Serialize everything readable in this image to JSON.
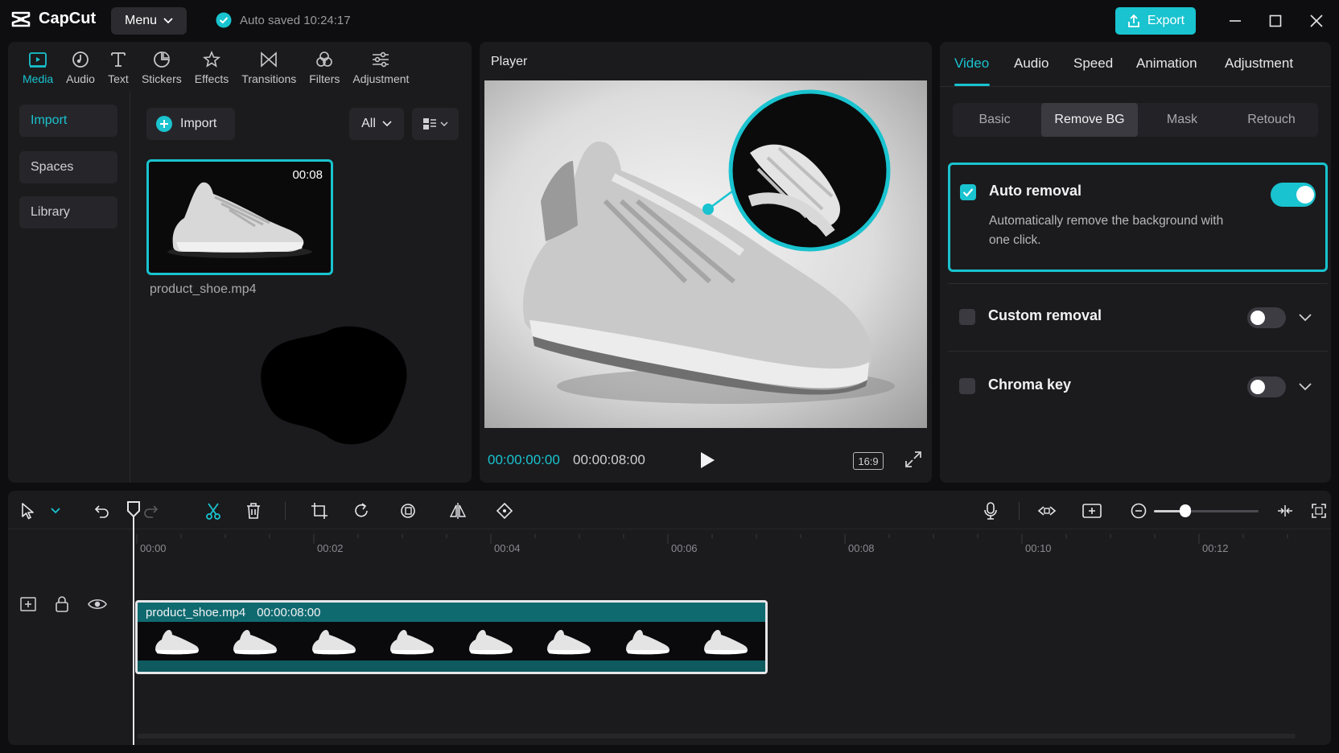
{
  "app": {
    "name": "CapCut",
    "menu_label": "Menu",
    "autosave_text": "Auto saved 10:24:17",
    "export_label": "Export"
  },
  "media_tabs": [
    {
      "label": "Media",
      "icon": "media-icon",
      "active": true
    },
    {
      "label": "Audio",
      "icon": "audio-icon"
    },
    {
      "label": "Text",
      "icon": "text-icon"
    },
    {
      "label": "Stickers",
      "icon": "stickers-icon"
    },
    {
      "label": "Effects",
      "icon": "effects-icon"
    },
    {
      "label": "Transitions",
      "icon": "transitions-icon"
    },
    {
      "label": "Filters",
      "icon": "filters-icon"
    },
    {
      "label": "Adjustment",
      "icon": "adjustment-icon"
    }
  ],
  "left_nav": [
    {
      "label": "Import",
      "active": true
    },
    {
      "label": "Spaces"
    },
    {
      "label": "Library"
    }
  ],
  "media": {
    "import_label": "Import",
    "filter_label": "All",
    "item": {
      "duration": "00:08",
      "filename": "product_shoe.mp4"
    }
  },
  "player": {
    "title": "Player",
    "time_current": "00:00:00:00",
    "time_total": "00:00:08:00",
    "aspect_ratio": "16:9"
  },
  "properties": {
    "tabs": [
      {
        "label": "Video",
        "active": true
      },
      {
        "label": "Audio"
      },
      {
        "label": "Speed"
      },
      {
        "label": "Animation"
      },
      {
        "label": "Adjustment"
      }
    ],
    "sub_tabs": [
      {
        "label": "Basic"
      },
      {
        "label": "Remove BG",
        "active": true
      },
      {
        "label": "Mask"
      },
      {
        "label": "Retouch"
      }
    ],
    "auto_removal": {
      "title": "Auto removal",
      "description": "Automatically remove the background with one click.",
      "checked": true,
      "enabled": true
    },
    "custom_removal": {
      "title": "Custom removal",
      "checked": false,
      "enabled": false
    },
    "chroma_key": {
      "title": "Chroma key",
      "checked": false,
      "enabled": false
    }
  },
  "timeline": {
    "ruler_labels": [
      "00:00",
      "00:02",
      "00:04",
      "00:06",
      "00:08",
      "00:10",
      "00:12"
    ],
    "clip": {
      "filename": "product_shoe.mp4",
      "duration": "00:00:08:00"
    }
  },
  "colors": {
    "accent": "#19c3cf",
    "panel": "#1b1b1e",
    "background": "#0e0e10"
  }
}
